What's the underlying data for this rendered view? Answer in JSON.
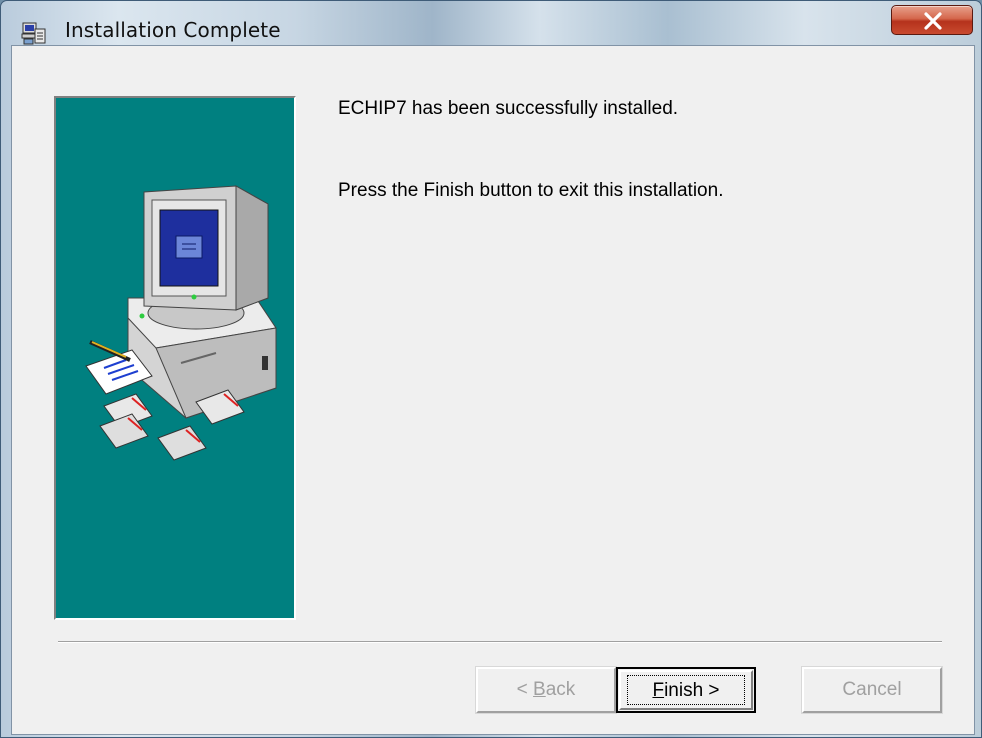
{
  "window": {
    "title": "Installation Complete",
    "close_label": "X"
  },
  "content": {
    "message_installed": "ECHIP7 has been successfully installed.",
    "message_finish": "Press the Finish button to exit this installation.",
    "side_image": "computer-with-floppy-disks-illustration"
  },
  "buttons": {
    "back": {
      "accel": "B",
      "rest": "ack",
      "prefix": "< ",
      "enabled": false
    },
    "finish": {
      "accel": "F",
      "rest": "inish >",
      "enabled": true,
      "default": true
    },
    "cancel": {
      "label": "Cancel",
      "enabled": false
    }
  },
  "icons": {
    "app": "installer-computer-icon",
    "close": "close-icon"
  },
  "colors": {
    "panel": "#008080",
    "dialog": "#f0f0f0",
    "close_button": "#c94a2f"
  }
}
